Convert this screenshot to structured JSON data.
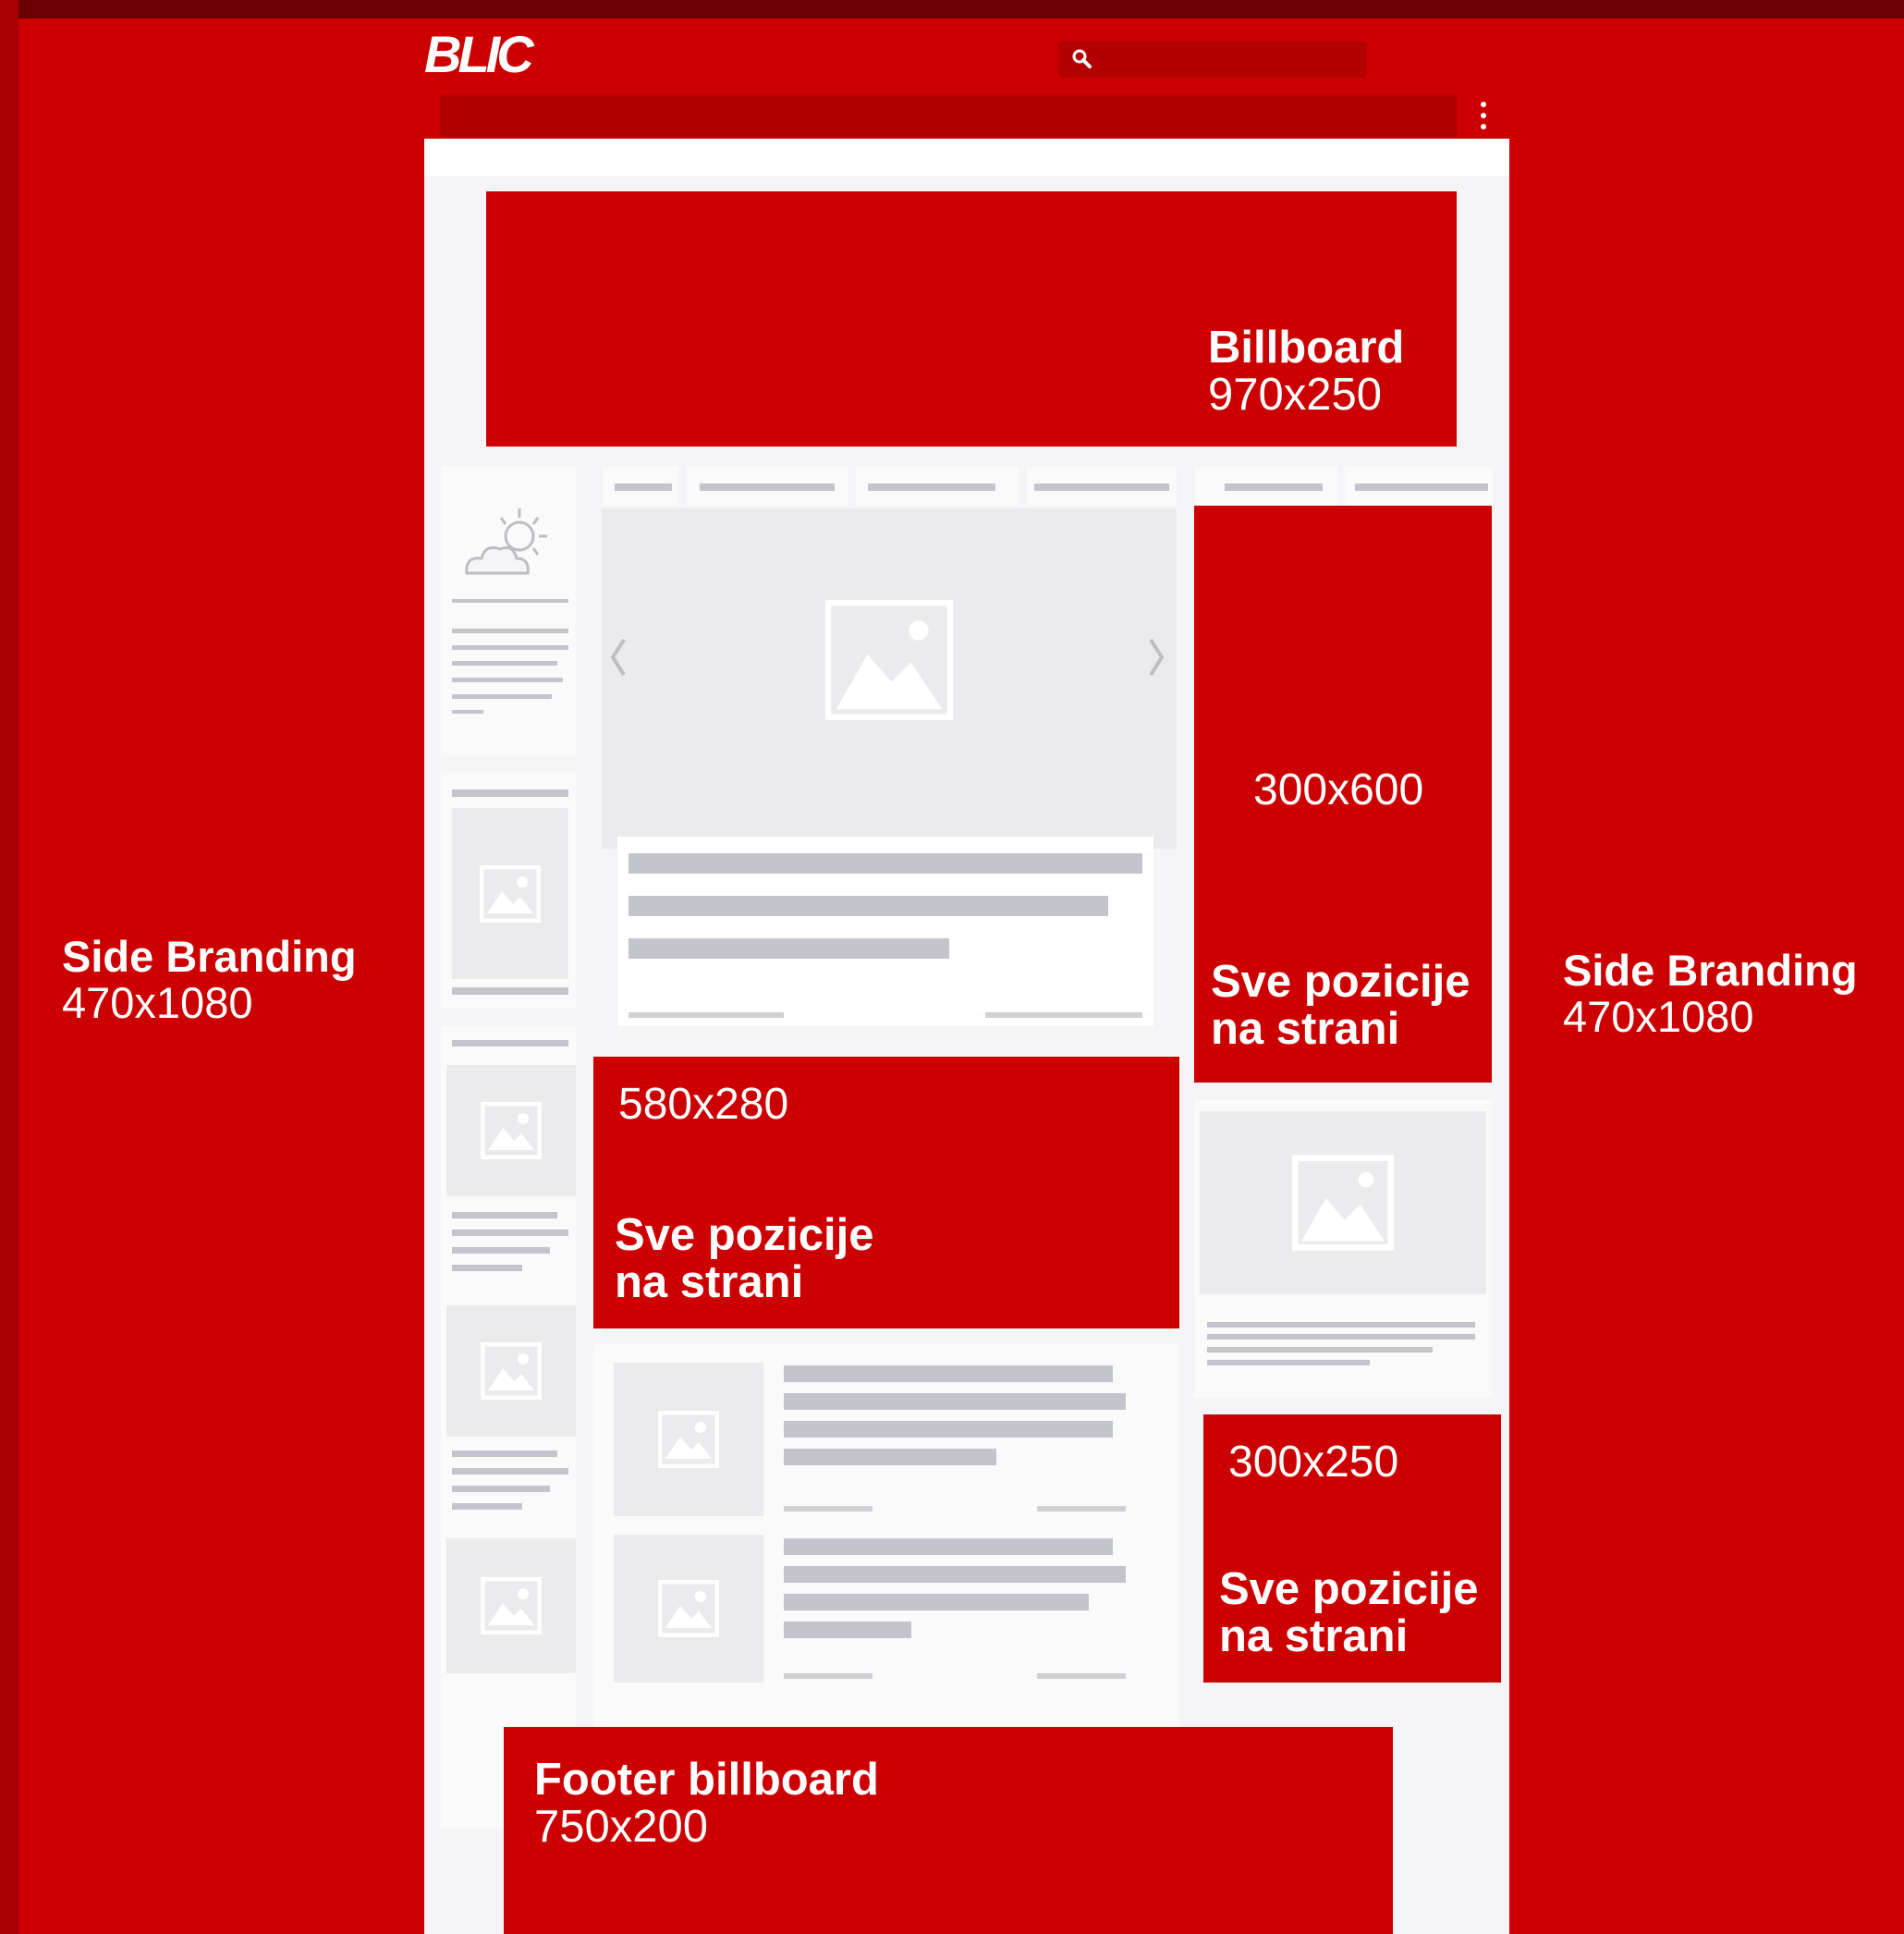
{
  "header": {
    "logo": "BLIC",
    "search_placeholder": ""
  },
  "ads": {
    "billboard": {
      "name": "Billboard",
      "size": "970x250"
    },
    "side_left": {
      "name": "Side Branding",
      "size": "470x1080"
    },
    "side_right": {
      "name": "Side Branding",
      "size": "470x1080"
    },
    "half_page": {
      "size": "300x600",
      "note_line1": "Sve pozicije",
      "note_line2": "na strani"
    },
    "inline": {
      "size": "580x280",
      "note_line1": "Sve pozicije",
      "note_line2": "na strani"
    },
    "rectangle": {
      "size": "300x250",
      "note_line1": "Sve pozicije",
      "note_line2": "na strani"
    },
    "footer": {
      "name": "Footer billboard",
      "size": "750x200"
    }
  },
  "icons": {
    "search": "search-icon",
    "menu": "kebab-menu-icon",
    "weather": "weather-sun-cloud-icon",
    "image": "image-placeholder-icon",
    "prev": "chevron-left-icon",
    "next": "chevron-right-icon"
  },
  "colors": {
    "brand_red": "#cc0000",
    "dark_red": "#b00000",
    "placeholder_gray": "#c4c4cc",
    "content_bg": "#f5f5f7"
  }
}
